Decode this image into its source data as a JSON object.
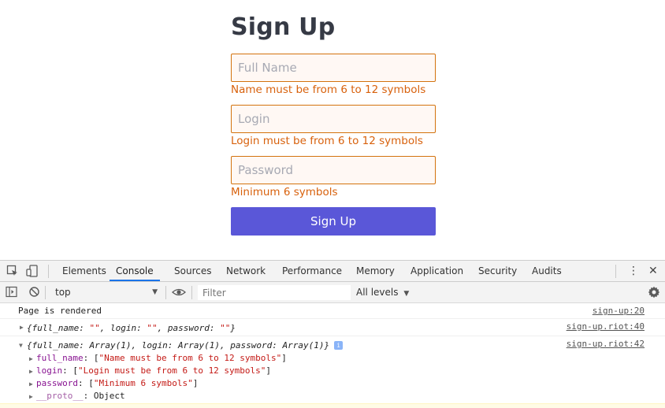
{
  "form": {
    "title": "Sign Up",
    "full_name": {
      "placeholder": "Full Name",
      "value": "",
      "error": "Name must be from 6 to 12 symbols"
    },
    "login": {
      "placeholder": "Login",
      "value": "",
      "error": "Login must be from 6 to 12 symbols"
    },
    "password": {
      "placeholder": "Password",
      "value": "",
      "error": "Minimum 6 symbols"
    },
    "submit_label": "Sign Up"
  },
  "devtools": {
    "tabs": [
      "Elements",
      "Console",
      "Sources",
      "Network",
      "Performance",
      "Memory",
      "Application",
      "Security",
      "Audits"
    ],
    "active_tab": "Console",
    "context": "top",
    "filter_placeholder": "Filter",
    "levels_label": "All levels",
    "accent_color": "#1a73e8",
    "console": {
      "log1": {
        "text": "Page is rendered",
        "source": "sign-up:20"
      },
      "log2": {
        "source": "sign-up.riot:40",
        "open": "{full_name: ",
        "v1": "\"\"",
        "mid1": ", login: ",
        "v2": "\"\"",
        "mid2": ", password: ",
        "v3": "\"\"",
        "close": "}"
      },
      "log3": {
        "source": "sign-up.riot:42",
        "summary": "{full_name: Array(1), login: Array(1), password: Array(1)}",
        "info_badge": "i",
        "props": [
          {
            "key": "full_name",
            "value": "\"Name must be from 6 to 12 symbols\""
          },
          {
            "key": "login",
            "value": "\"Login must be from 6 to 12 symbols\""
          },
          {
            "key": "password",
            "value": "\"Minimum 6 symbols\""
          }
        ],
        "proto_key": "__proto__",
        "proto_value": "Object"
      }
    }
  },
  "colors": {
    "error": "#d8610c",
    "field_border": "#d3730e",
    "button": "#5a57d8",
    "title": "#363a45"
  }
}
